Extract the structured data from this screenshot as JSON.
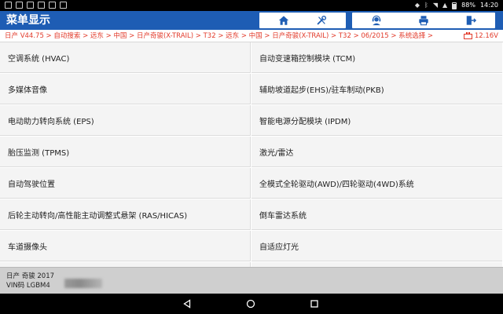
{
  "status_bar": {
    "time": "14:20",
    "battery_level": "88%"
  },
  "header": {
    "title": "菜单显示"
  },
  "toolbar": {
    "buttons": [
      {
        "icon": "home-icon"
      },
      {
        "icon": "diagnostic-tool-icon"
      },
      {
        "icon": "support-agent-icon"
      },
      {
        "icon": "print-icon"
      },
      {
        "icon": "exit-icon"
      }
    ]
  },
  "breadcrumb": {
    "path": "日产 V44.75 > 自动搜索 > 远东 > 中国 > 日产奇骏(X-TRAIL) > T32 > 远东 > 中国 > 日产奇骏(X-TRAIL) > T32 > 06/2015 > 系统选择 >",
    "voltage": "12.16V"
  },
  "systems": {
    "left": [
      "空调系统 (HVAC)",
      "多媒体音像",
      "电动助力转向系统 (EPS)",
      "胎压监测 (TPMS)",
      "自动驾驶位置",
      "后轮主动转向/高性能主动调整式悬架 (RAS/HICAS)",
      "车道摄像头"
    ],
    "right": [
      "自动变速箱控制模块 (TCM)",
      "辅助坡道起步(EHS)/驻车制动(PKB)",
      "智能电源分配模块 (IPDM)",
      "激光/雷达",
      "全模式全轮驱动(AWD)/四轮驱动(4WD)系统",
      "倒车雷达系统",
      "自适应灯光"
    ]
  },
  "footer": {
    "vehicle": "日产 奇骏 2017",
    "vin": "VIN码 LGBM4"
  },
  "colors": {
    "titlebar": "#1e5db4",
    "breadcrumb_text": "#e23a2a",
    "cell_bg": "#f4f4f4",
    "footer_bg": "#cfcfcf"
  }
}
